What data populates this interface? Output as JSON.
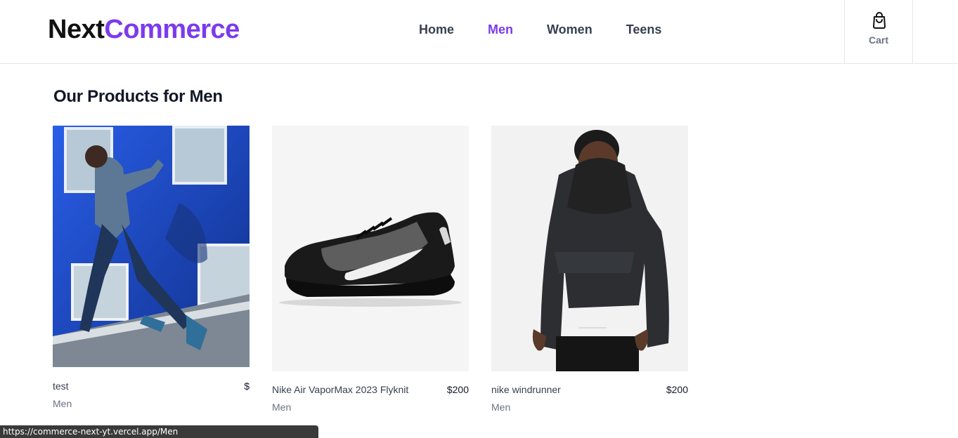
{
  "brand": {
    "part1": "Next",
    "part2": "Commerce"
  },
  "nav": [
    {
      "label": "Home",
      "active": false
    },
    {
      "label": "Men",
      "active": true
    },
    {
      "label": "Women",
      "active": false
    },
    {
      "label": "Teens",
      "active": false
    }
  ],
  "cart": {
    "label": "Cart",
    "icon": "shopping-bag-icon"
  },
  "page_title": "Our Products for Men",
  "products": [
    {
      "name": "test",
      "price": "$",
      "category": "Men",
      "image": "runner-in-blue-jacket-photo"
    },
    {
      "name": "Nike Air VaporMax 2023 Flyknit",
      "price": "$200",
      "category": "Men",
      "image": "black-sneaker-photo"
    },
    {
      "name": "nike windrunner",
      "price": "$200",
      "category": "Men",
      "image": "black-jacket-back-photo"
    }
  ],
  "status_url": "https://commerce-next-yt.vercel.app/Men",
  "colors": {
    "accent": "#7c3aed",
    "text": "#111827",
    "muted": "#6b7280"
  }
}
